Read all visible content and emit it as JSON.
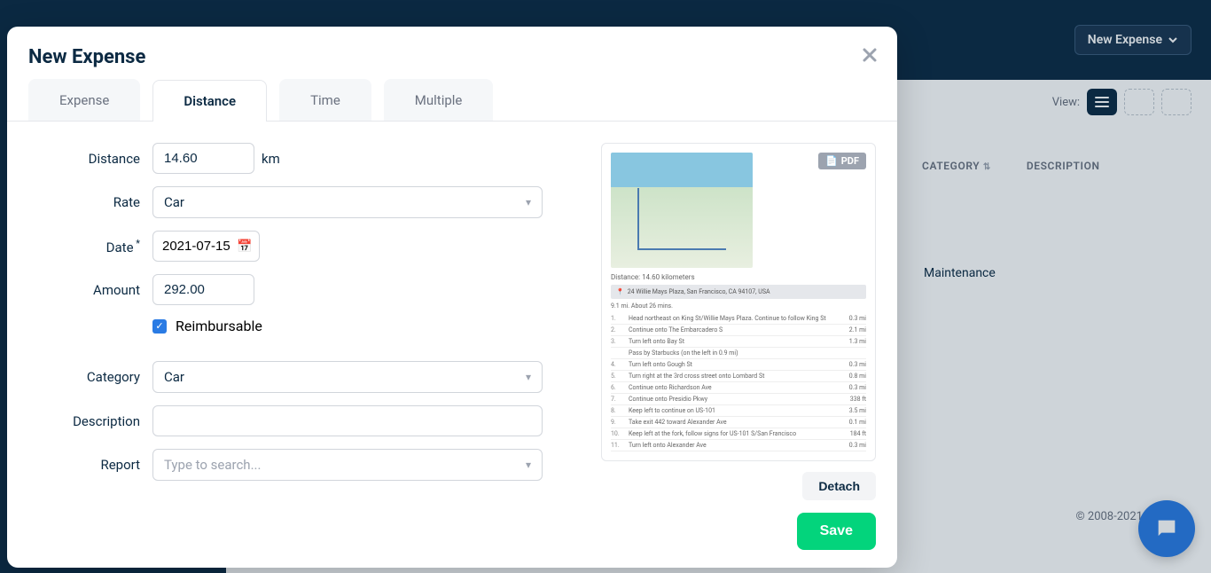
{
  "bg": {
    "new_expense_btn": "New Expense",
    "view_label": "View:",
    "headers": {
      "category": "CATEGORY",
      "description": "DESCRIPTION"
    },
    "row_category": "Maintenance",
    "footer": "© 2008-2021 Ex"
  },
  "modal": {
    "title": "New Expense",
    "tabs": {
      "expense": "Expense",
      "distance": "Distance",
      "time": "Time",
      "multiple": "Multiple"
    },
    "form": {
      "distance_label": "Distance",
      "distance_value": "14.60",
      "distance_unit": "km",
      "rate_label": "Rate",
      "rate_value": "Car",
      "date_label": "Date",
      "date_value": "2021-07-15",
      "amount_label": "Amount",
      "amount_value": "292.00",
      "reimbursable_label": "Reimbursable",
      "category_label": "Category",
      "category_value": "Car",
      "description_label": "Description",
      "description_value": "",
      "report_label": "Report",
      "report_placeholder": "Type to search..."
    },
    "attachment": {
      "pdf_badge": "PDF",
      "distance_meta": "Distance: 14.60 kilometers",
      "address": "24 Willie Mays Plaza, San Francisco, CA 94107, USA",
      "summary": "9.1 mi. About 26 mins.",
      "directions": [
        {
          "n": "1.",
          "t": "Head northeast on King St/Willie Mays Plaza. Continue to follow King St",
          "d": "0.3 mi"
        },
        {
          "n": "2.",
          "t": "Continue onto The Embarcadero S",
          "d": "2.1 mi"
        },
        {
          "n": "3.",
          "t": "Turn left onto Bay St",
          "d": "1.3 mi"
        },
        {
          "n": "",
          "t": "Pass by Starbucks (on the left in 0.9 mi)",
          "d": ""
        },
        {
          "n": "4.",
          "t": "Turn left onto Gough St",
          "d": "0.3 mi"
        },
        {
          "n": "5.",
          "t": "Turn right at the 3rd cross street onto Lombard St",
          "d": "0.8 mi"
        },
        {
          "n": "6.",
          "t": "Continue onto Richardson Ave",
          "d": "0.3 mi"
        },
        {
          "n": "7.",
          "t": "Continue onto Presidio Pkwy",
          "d": "338 ft"
        },
        {
          "n": "8.",
          "t": "Keep left to continue on US-101",
          "d": "3.5 mi"
        },
        {
          "n": "9.",
          "t": "Take exit 442 toward Alexander Ave",
          "d": "0.1 mi"
        },
        {
          "n": "10.",
          "t": "Keep left at the fork, follow signs for US-101 S/San Francisco",
          "d": "184 ft"
        },
        {
          "n": "11.",
          "t": "Turn left onto Alexander Ave",
          "d": "0.3 mi"
        }
      ],
      "detach_label": "Detach"
    },
    "save_label": "Save"
  }
}
